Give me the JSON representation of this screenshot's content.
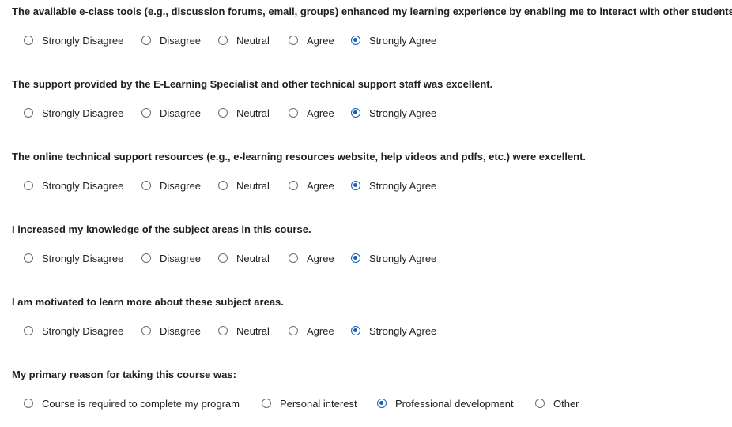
{
  "likert_options": [
    "Strongly Disagree",
    "Disagree",
    "Neutral",
    "Agree",
    "Strongly Agree"
  ],
  "questions": [
    {
      "text": "The available e-class tools (e.g., discussion forums, email, groups) enhanced my learning experience by enabling me to interact with other students.",
      "selected": "Strongly Agree"
    },
    {
      "text": "The support provided by the E-Learning Specialist and other technical support staff was excellent.",
      "selected": "Strongly Agree"
    },
    {
      "text": "The online technical support resources (e.g., e-learning resources website, help videos and pdfs, etc.) were excellent.",
      "selected": "Strongly Agree"
    },
    {
      "text": "I increased my knowledge of the subject areas in this course.",
      "selected": "Strongly Agree"
    },
    {
      "text": "I am motivated to learn more about these subject areas.",
      "selected": "Strongly Agree"
    }
  ],
  "reason": {
    "text": "My primary reason for taking this course was:",
    "options": [
      "Course is required to complete my program",
      "Personal interest",
      "Professional development",
      "Other"
    ],
    "selected": "Professional development"
  }
}
